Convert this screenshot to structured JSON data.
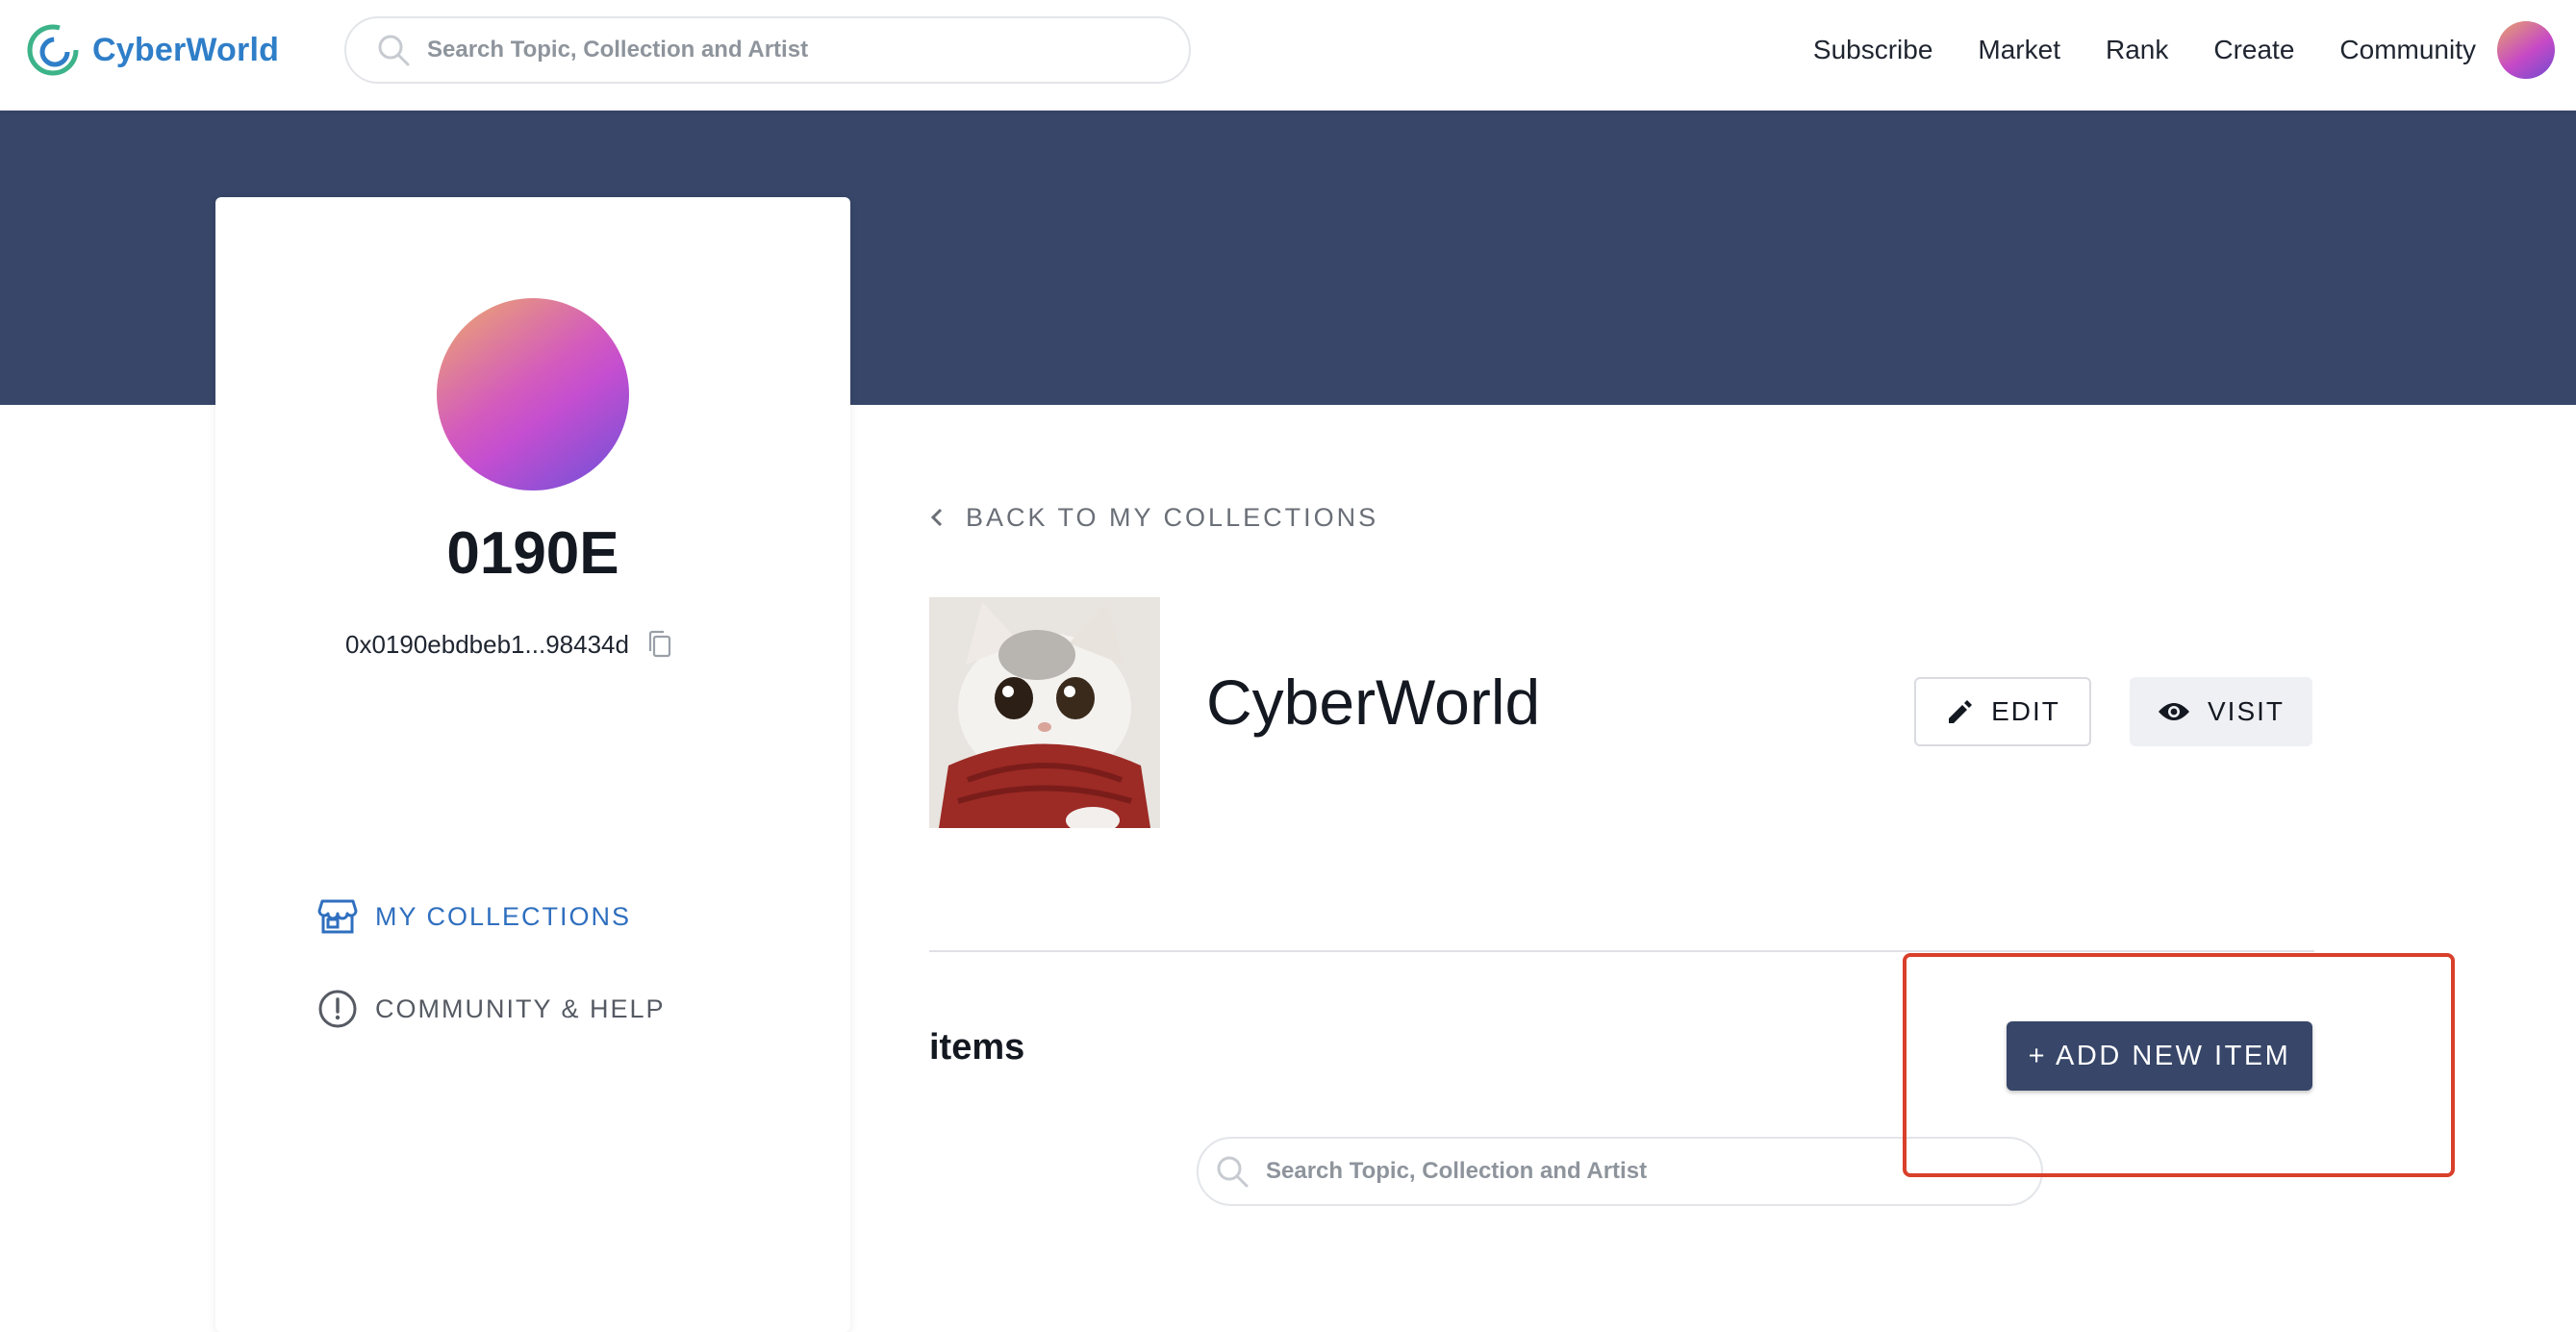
{
  "header": {
    "logo_text": "CyberWorld",
    "search_placeholder": "Search Topic, Collection and Artist",
    "nav": [
      "Subscribe",
      "Market",
      "Rank",
      "Create",
      "Community"
    ]
  },
  "profile": {
    "username": "0190E",
    "address": "0x0190ebdbeb1...98434d",
    "menu": {
      "collections": "MY COLLECTIONS",
      "help": "COMMUNITY & HELP"
    }
  },
  "collection": {
    "back_label": "BACK TO MY COLLECTIONS",
    "title": "CyberWorld",
    "edit_label": "EDIT",
    "visit_label": "VISIT",
    "items_heading": "items",
    "add_item_label": "+ ADD NEW ITEM",
    "items_search_placeholder": "Search Topic, Collection and Artist"
  },
  "colors": {
    "brand_blue": "#2f7ec8",
    "brand_green": "#3db38a",
    "banner": "#374669",
    "accent_link": "#2f6fbf",
    "highlight": "#d9402b"
  },
  "icons": [
    "search-icon",
    "copy-icon",
    "store-icon",
    "alert-icon",
    "chevron-left-icon",
    "pencil-icon",
    "eye-icon"
  ]
}
